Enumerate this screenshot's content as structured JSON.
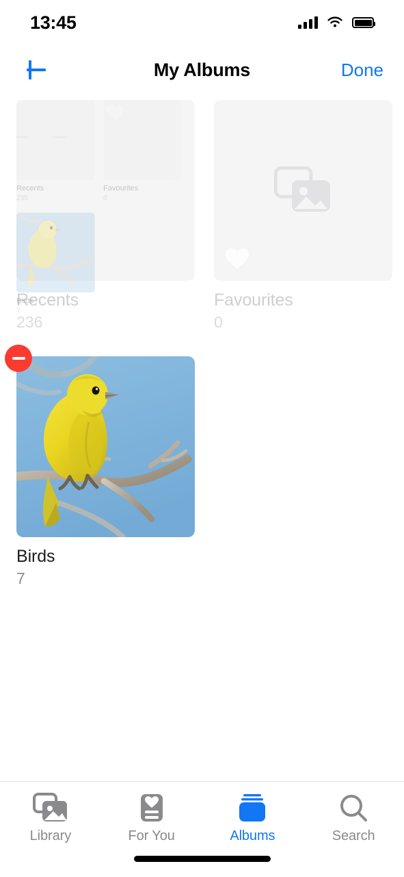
{
  "status_bar": {
    "time": "13:45",
    "signal_icon": "cellular-signal-icon",
    "wifi_icon": "wifi-icon",
    "battery_icon": "battery-full-icon"
  },
  "nav_bar": {
    "add_icon": "plus-icon",
    "title": "My Albums",
    "done_label": "Done"
  },
  "albums": [
    {
      "title": "Recents",
      "count": "236",
      "state": "dimmed",
      "art": "none",
      "deletable": false
    },
    {
      "title": "Favourites",
      "count": "0",
      "state": "dimmed",
      "art": "placeholder",
      "deletable": false
    },
    {
      "title": "Birds",
      "count": "7",
      "state": "normal",
      "art": "photo",
      "deletable": true,
      "photo_description": "Yellow canary perched on a bare branch against a blue sky"
    }
  ],
  "ghost_overlay": {
    "visible": true,
    "albums": [
      {
        "title": "Recents",
        "count": "235"
      },
      {
        "title": "Favourites",
        "count": "0"
      },
      {
        "title": "Birds",
        "count": "7"
      }
    ]
  },
  "delete_badge": {
    "icon": "minus-circle-icon",
    "color": "#fc3b30"
  },
  "tab_bar": {
    "tabs": [
      {
        "label": "Library",
        "icon": "photo-stack-icon",
        "active": false
      },
      {
        "label": "For You",
        "icon": "heart-card-icon",
        "active": false
      },
      {
        "label": "Albums",
        "icon": "albums-book-icon",
        "active": true
      },
      {
        "label": "Search",
        "icon": "magnifier-icon",
        "active": false
      }
    ]
  },
  "colors": {
    "accent": "#1277f2",
    "delete_red": "#fc3b30",
    "tile_bg": "#f4f4f5",
    "label_gray": "#8e8e93",
    "sky_blue": "#7fb4dc",
    "canary_yellow": "#e8d520"
  },
  "home_indicator": "home-indicator"
}
